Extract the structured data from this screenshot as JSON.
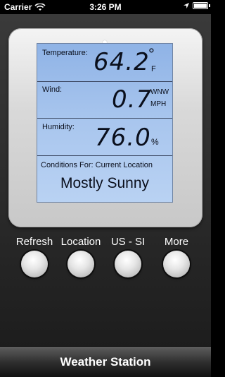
{
  "status_bar": {
    "carrier": "Carrier",
    "time": "3:26 PM"
  },
  "display": {
    "temperature": {
      "label": "Temperature:",
      "value": "64.2",
      "unit_symbol": "°",
      "unit": "F"
    },
    "wind": {
      "label": "Wind:",
      "value": "0.7",
      "direction": "WNW",
      "unit": "MPH"
    },
    "humidity": {
      "label": "Humidity:",
      "value": "76.0",
      "unit": "%"
    },
    "conditions": {
      "label": "Conditions For:  Current Location",
      "value": "Mostly Sunny"
    }
  },
  "buttons": [
    {
      "label": "Refresh"
    },
    {
      "label": "Location"
    },
    {
      "label": "US - SI"
    },
    {
      "label": "More"
    }
  ],
  "bottom_bar": {
    "title": "Weather Station"
  }
}
